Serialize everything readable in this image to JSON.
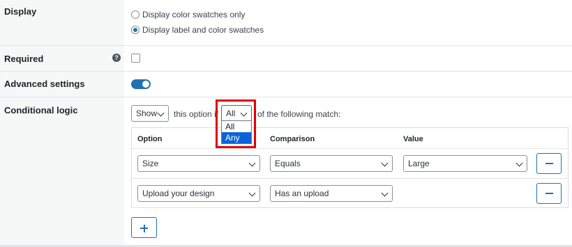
{
  "rows": {
    "display": {
      "label": "Display",
      "options": [
        {
          "label": "Display color swatches only",
          "checked": false
        },
        {
          "label": "Display label and color swatches",
          "checked": true
        }
      ]
    },
    "required": {
      "label": "Required",
      "help_icon": "?",
      "checked": false
    },
    "advanced": {
      "label": "Advanced settings",
      "enabled": true
    },
    "conditional": {
      "label": "Conditional logic",
      "action_select": "Show",
      "text_before": "this option if",
      "match_select": "All",
      "text_after": "of the following match:",
      "match_options": [
        {
          "label": "All",
          "active": false
        },
        {
          "label": "Any",
          "active": true
        }
      ],
      "table": {
        "headers": {
          "option": "Option",
          "comparison": "Comparison",
          "value": "Value"
        },
        "rules": [
          {
            "option": "Size",
            "comparison": "Equals",
            "value": "Large"
          },
          {
            "option": "Upload your design",
            "comparison": "Has an upload",
            "value": null
          }
        ]
      }
    }
  },
  "colors": {
    "accent": "#2271b1",
    "highlight": "#e00000",
    "label_bg": "#f6f7f7"
  }
}
